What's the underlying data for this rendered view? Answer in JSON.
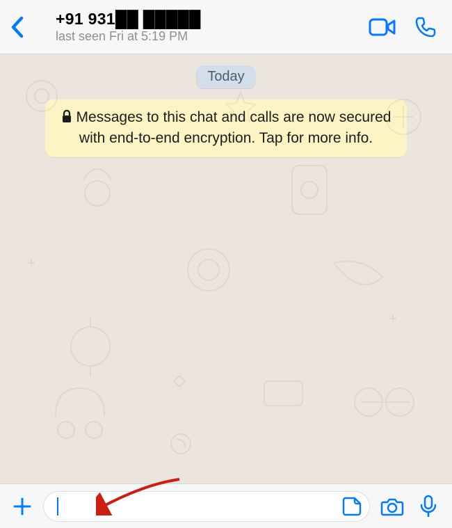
{
  "header": {
    "contact_name": "+91 931██ █████",
    "last_seen": "last seen Fri at 5:19 PM",
    "icons": {
      "back": "chevron-left",
      "video": "video-camera",
      "call": "phone"
    }
  },
  "chat": {
    "date_badge": "Today",
    "encryption_notice": "Messages to this chat and calls are now secured with end-to-end encryption. Tap for more info.",
    "lock_icon": "lock"
  },
  "input": {
    "placeholder": "",
    "value": "",
    "icons": {
      "add": "plus",
      "sticker": "sticker",
      "camera": "camera",
      "mic": "microphone"
    }
  },
  "colors": {
    "accent": "#007aff",
    "bg_chat": "#ece5dd",
    "bg_bars": "#f7f7f7",
    "date_badge_bg": "#d4deea",
    "notice_bg": "#fdf4c5",
    "arrow": "#cc1e12"
  }
}
